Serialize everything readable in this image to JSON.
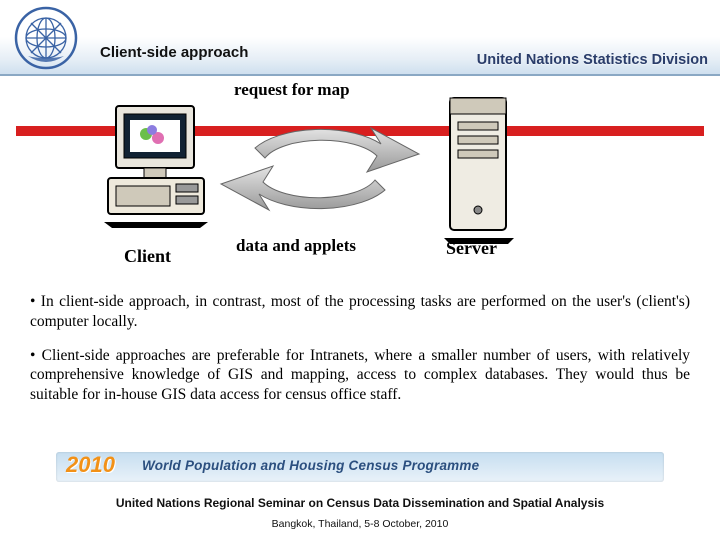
{
  "header": {
    "title": "Client-side approach",
    "subhead": "United Nations Statistics Division"
  },
  "diagram": {
    "top_label": "request for map",
    "bottom_label": "data and applets",
    "client_label": "Client",
    "server_label": "Server"
  },
  "bullets": {
    "b1": "• In client-side approach, in contrast, most of the processing tasks are performed on the user's (client's) computer locally.",
    "b2": "• Client-side approaches are preferable for Intranets, where a smaller number of users, with relatively comprehensive knowledge of GIS and mapping, access to complex databases. They would thus be suitable for in-house GIS data access for census office staff."
  },
  "census": {
    "year": "2010",
    "text": "World Population and Housing Census Programme"
  },
  "footer": {
    "line1": "United Nations Regional Seminar on Census Data Dissemination and Spatial Analysis",
    "line2": "Bangkok, Thailand, 5-8 October, 2010"
  }
}
